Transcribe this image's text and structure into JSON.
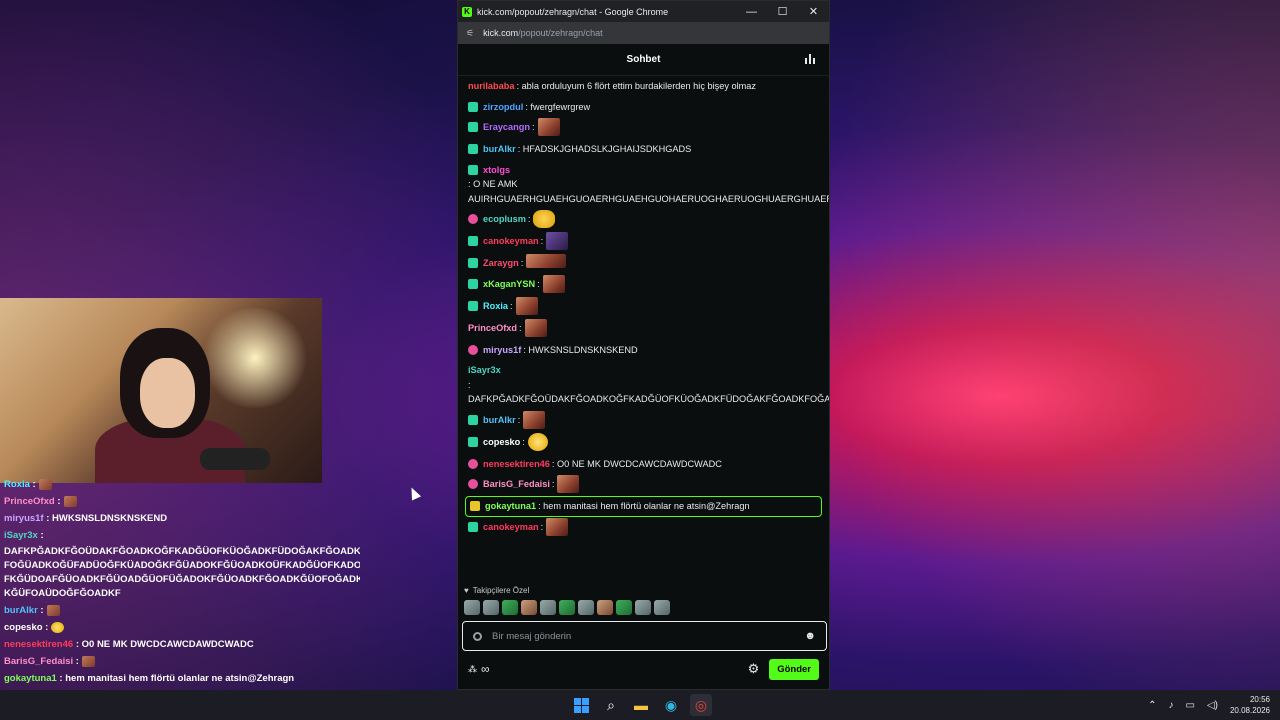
{
  "window": {
    "title": "kick.com/popout/zehragn/chat - Google Chrome",
    "url_host": "kick.com",
    "url_path": "/popout/zehragn/chat",
    "minimize": "—",
    "maximize": "☐",
    "close": "✕"
  },
  "chat": {
    "header_title": "Sohbet",
    "messages": [
      {
        "user": "nurilababa",
        "color": "#ff4d4d",
        "badge": "",
        "text": ": abla orduluyum 6 flört ettim burdakilerden hiç bişey olmaz"
      },
      {
        "user": "zirzopdul",
        "color": "#4fa3ff",
        "badge": "sub",
        "text": ": fwergfewrgrew"
      },
      {
        "user": "Eraycangn",
        "color": "#b36bff",
        "badge": "sub",
        "text": ":",
        "emote": "face"
      },
      {
        "user": "burAlkr",
        "color": "#4fc3f7",
        "badge": "sub",
        "text": ": HFADSKJGHADSLKJGHAIJSDKHGADS"
      },
      {
        "user": "xtolgs",
        "color": "#ff4dd2",
        "badge": "sub",
        "text": ": O NE AMK AUIRHGUAERHGUAEHGUOAERHGUAEHGUOHAERUOGHAERUOGHUAERGHUAERHGAERG"
      },
      {
        "user": "ecoplusm",
        "color": "#4fd6c4",
        "badge": "gift",
        "text": ":",
        "emote": "hand"
      },
      {
        "user": "canokeyman",
        "color": "#ff3b5c",
        "badge": "sub",
        "text": ":",
        "emote": "face2"
      },
      {
        "user": "Zaraygn",
        "color": "#ff4d6d",
        "badge": "sub",
        "text": ":",
        "emote": "wide"
      },
      {
        "user": "xKaganYSN",
        "color": "#7dff5a",
        "badge": "sub",
        "text": ":",
        "emote": "face"
      },
      {
        "user": "Roxia",
        "color": "#4ff0ff",
        "badge": "sub",
        "text": ":",
        "emote": "face"
      },
      {
        "user": "PrinceOfxd",
        "color": "#ff8fc8",
        "badge": "",
        "text": ":",
        "emote": "face"
      },
      {
        "user": "miryus1f",
        "color": "#c6a7ff",
        "badge": "gift",
        "text": ": HWKSNSLDNSKNSKEND"
      },
      {
        "user": "iSayr3x",
        "color": "#4fd6c4",
        "badge": "",
        "text": ": DAFKPĞADKFĞOÜDAKFĞOADKOĞFKADĞÜOFKÜOĞADKFÜDOĞAKFĞOADKFOĞADKFOĞÜADKOĞÜFADÜOĞFKÜADOĞKFĞÜADOKFĞÜOADKOÜFKADĞÜOFKADOFKÜADOFKĞÜDOAFĞÜOADKFĞÜOADĞÜOFÜĞADOKFĞÜOADKFĞOADKĞÜOFOĞADKFÜĞOADKĞÜFOAÜDOĞFĞOADKF"
      },
      {
        "user": "burAlkr",
        "color": "#4fc3f7",
        "badge": "sub",
        "text": ":",
        "emote": "face"
      },
      {
        "user": "copesko",
        "color": "#ffffff",
        "badge": "sub",
        "text": ":",
        "emote": "cry"
      },
      {
        "user": "nenesektiren46",
        "color": "#ff3b5c",
        "badge": "gift",
        "text": ": O0 NE MK DWCDCAWCDAWDCWADC"
      },
      {
        "user": "BarisG_Fedaisi",
        "color": "#ff8fc8",
        "badge": "gift",
        "text": ":",
        "emote": "face"
      },
      {
        "user": "gokaytuna1",
        "color": "#7dff5a",
        "badge": "vip",
        "text": ": hem manitasi hem flörtü olanlar ne atsin@Zehragn",
        "highlight": true
      },
      {
        "user": "canokeyman",
        "color": "#ff3b5c",
        "badge": "sub",
        "text": ":",
        "emote": "face"
      }
    ],
    "followers_label": "Takipçilere Özel",
    "input_placeholder": "Bir mesaj gönderin",
    "send_label": "Gönder",
    "colors": {
      "accent": "#53fc18",
      "background": "#0b0e0f"
    }
  },
  "overlay": {
    "lines": [
      {
        "user": "Roxia",
        "color": "#4ff0ff",
        "text": " :",
        "emote": true
      },
      {
        "user": "PrinceOfxd",
        "color": "#ff8fc8",
        "text": " :",
        "emote": true
      },
      {
        "user": "miryus1f",
        "color": "#c6a7ff",
        "text": " : HWKSNSLDNSKNSKEND"
      },
      {
        "user": "iSayr3x",
        "color": "#4fd6c4",
        "text": " :",
        "wrap": "DAFKPĞADKFĞOÜDAKFĞOADKOĞFKADĞÜOFKÜOĞADKFÜDOĞAKFĞOADKFĞOADK FOĞÜADKOĞÜFADÜOĞFKÜADOĞKFĞÜADOKFĞÜOADKOÜFKADĞÜOFKADOFKÜADO FKĞÜDOAFĞÜOADKFĞÜOADĞÜOFÜĞADOKFĞÜOADKFĞOADKĞÜOFOĞADKFÜĞOAD KĞÜFOAÜDOĞFĞOADKF"
      },
      {
        "user": "burAlkr",
        "color": "#4fc3f7",
        "text": " :",
        "emote": true
      },
      {
        "user": "copesko",
        "color": "#ffffff",
        "text": " :",
        "emote": "yellow"
      },
      {
        "user": "nenesektiren46",
        "color": "#ff3b5c",
        "text": " : O0 NE MK DWCDCAWCDAWDCWADC"
      },
      {
        "user": "BarisG_Fedaisi",
        "color": "#ff8fc8",
        "text": " :",
        "emote": true
      },
      {
        "user": "gokaytuna1",
        "color": "#7dff5a",
        "text": " : hem manitasi hem flörtü olanlar ne atsin@Zehragn"
      },
      {
        "user": "canokeyman",
        "color": "#ff3b5c",
        "text": " :",
        "emote": true
      }
    ]
  },
  "taskbar": {
    "time": "20:56",
    "date": "20.08.2026"
  }
}
